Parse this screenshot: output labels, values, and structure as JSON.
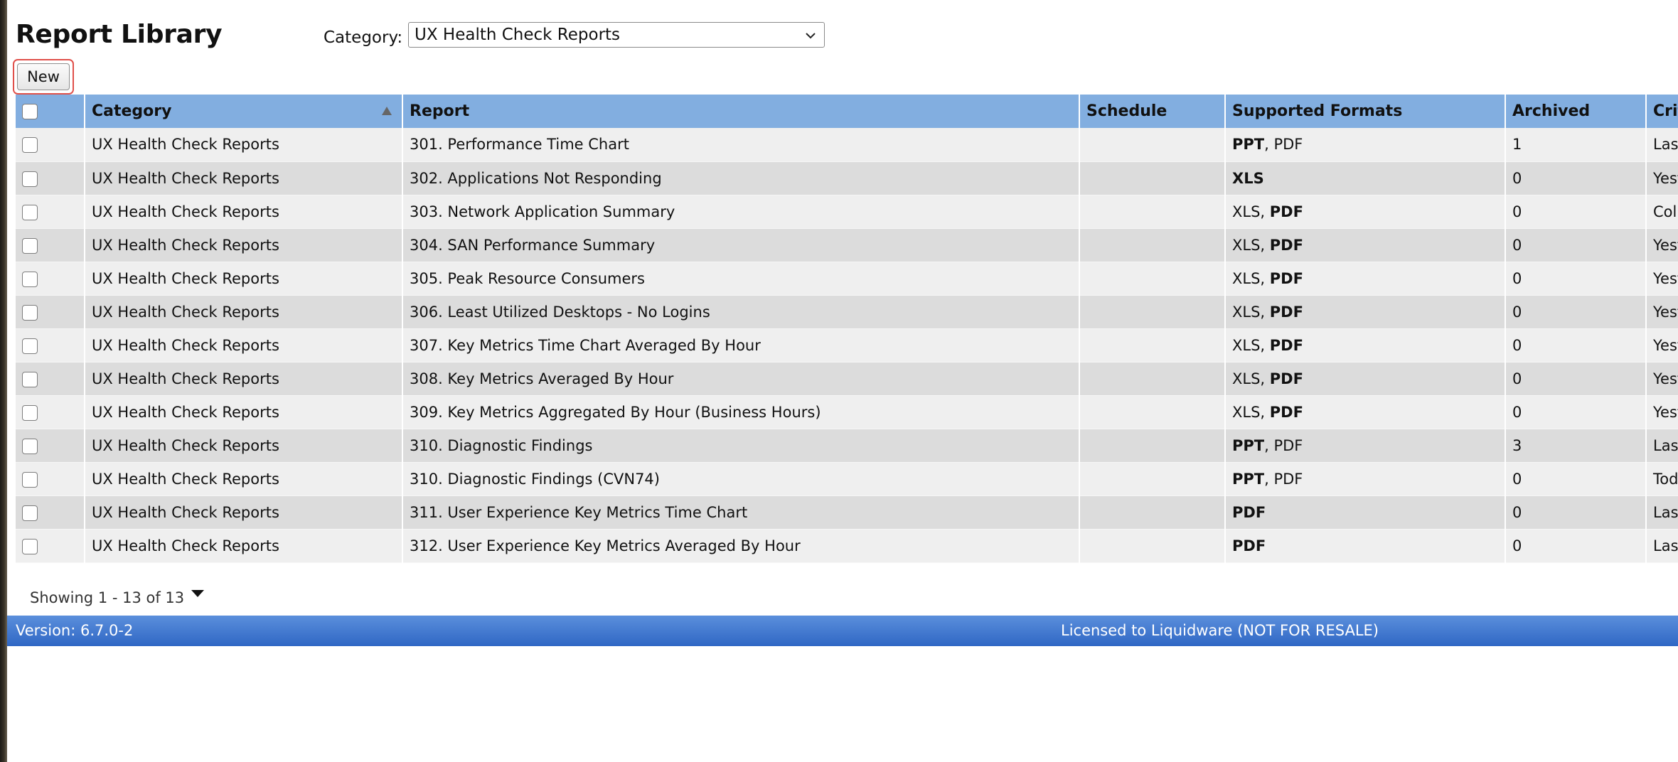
{
  "page": {
    "title": "Report Library",
    "category_label": "Category:",
    "category_selected": "UX Health Check Reports",
    "new_button": "New"
  },
  "table": {
    "columns": [
      "Category",
      "Report",
      "Schedule",
      "Supported Formats",
      "Archived",
      "Crit"
    ],
    "sort": {
      "column": "Category",
      "direction": "ascending"
    },
    "rows": [
      {
        "category": "UX Health Check Reports",
        "report": "301. Performance Time Chart",
        "schedule": "",
        "formats": [
          {
            "text": "PPT",
            "bold": true
          },
          {
            "text": "PDF",
            "bold": false
          }
        ],
        "archived": "1",
        "criteria": "Last"
      },
      {
        "category": "UX Health Check Reports",
        "report": "302. Applications Not Responding",
        "schedule": "",
        "formats": [
          {
            "text": "XLS",
            "bold": true
          }
        ],
        "archived": "0",
        "criteria": "Yest"
      },
      {
        "category": "UX Health Check Reports",
        "report": "303. Network Application Summary",
        "schedule": "",
        "formats": [
          {
            "text": "XLS",
            "bold": false
          },
          {
            "text": "PDF",
            "bold": true
          }
        ],
        "archived": "0",
        "criteria": "Colle"
      },
      {
        "category": "UX Health Check Reports",
        "report": "304. SAN Performance Summary",
        "schedule": "",
        "formats": [
          {
            "text": "XLS",
            "bold": false
          },
          {
            "text": "PDF",
            "bold": true
          }
        ],
        "archived": "0",
        "criteria": "Yest"
      },
      {
        "category": "UX Health Check Reports",
        "report": "305. Peak Resource Consumers",
        "schedule": "",
        "formats": [
          {
            "text": "XLS",
            "bold": false
          },
          {
            "text": "PDF",
            "bold": true
          }
        ],
        "archived": "0",
        "criteria": "Yest"
      },
      {
        "category": "UX Health Check Reports",
        "report": "306. Least Utilized Desktops - No Logins",
        "schedule": "",
        "formats": [
          {
            "text": "XLS",
            "bold": false
          },
          {
            "text": "PDF",
            "bold": true
          }
        ],
        "archived": "0",
        "criteria": "Yest"
      },
      {
        "category": "UX Health Check Reports",
        "report": "307. Key Metrics Time Chart Averaged By Hour",
        "schedule": "",
        "formats": [
          {
            "text": "XLS",
            "bold": false
          },
          {
            "text": "PDF",
            "bold": true
          }
        ],
        "archived": "0",
        "criteria": "Yest"
      },
      {
        "category": "UX Health Check Reports",
        "report": "308. Key Metrics Averaged By Hour",
        "schedule": "",
        "formats": [
          {
            "text": "XLS",
            "bold": false
          },
          {
            "text": "PDF",
            "bold": true
          }
        ],
        "archived": "0",
        "criteria": "Yest"
      },
      {
        "category": "UX Health Check Reports",
        "report": "309. Key Metrics Aggregated By Hour (Business Hours)",
        "schedule": "",
        "formats": [
          {
            "text": "XLS",
            "bold": false
          },
          {
            "text": "PDF",
            "bold": true
          }
        ],
        "archived": "0",
        "criteria": "Yest"
      },
      {
        "category": "UX Health Check Reports",
        "report": "310. Diagnostic Findings",
        "schedule": "",
        "formats": [
          {
            "text": "PPT",
            "bold": true
          },
          {
            "text": "PDF",
            "bold": false
          }
        ],
        "archived": "3",
        "criteria": "Last"
      },
      {
        "category": "UX Health Check Reports",
        "report": "310. Diagnostic Findings (CVN74)",
        "schedule": "",
        "formats": [
          {
            "text": "PPT",
            "bold": true
          },
          {
            "text": "PDF",
            "bold": false
          }
        ],
        "archived": "0",
        "criteria": "Toda"
      },
      {
        "category": "UX Health Check Reports",
        "report": "311. User Experience Key Metrics Time Chart",
        "schedule": "",
        "formats": [
          {
            "text": "PDF",
            "bold": true
          }
        ],
        "archived": "0",
        "criteria": "Last"
      },
      {
        "category": "UX Health Check Reports",
        "report": "312. User Experience Key Metrics Averaged By Hour",
        "schedule": "",
        "formats": [
          {
            "text": "PDF",
            "bold": true
          }
        ],
        "archived": "0",
        "criteria": "Last"
      }
    ]
  },
  "footer": {
    "showing": "Showing 1 - 13 of 13"
  },
  "status_bar": {
    "version": "Version: 6.7.0-2",
    "license": "Licensed to Liquidware (NOT FOR RESALE)"
  },
  "icons": {
    "sort": "sort-ascending-icon",
    "dropdown": "chevron-down-icon",
    "pager": "caret-down-icon"
  },
  "colors": {
    "header_bg": "#82aee0",
    "status_bar": "#3a73cc",
    "focus_ring": "#e0504a"
  }
}
